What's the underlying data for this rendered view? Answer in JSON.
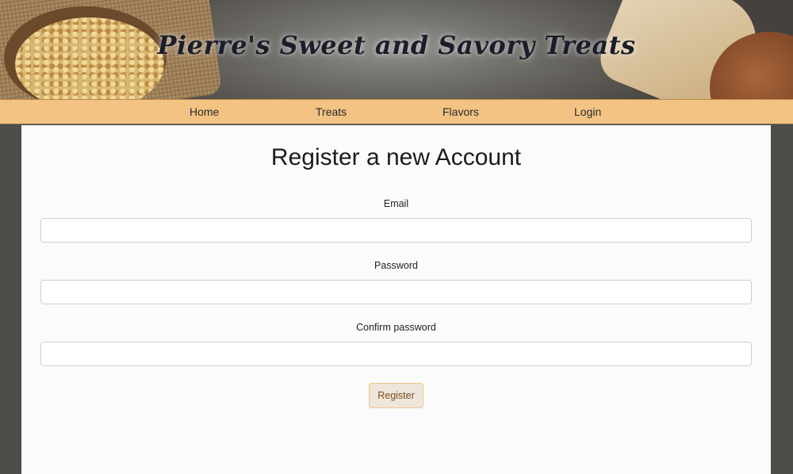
{
  "header": {
    "site_title": "Pierre's Sweet and Savory Treats"
  },
  "nav": {
    "items": [
      {
        "label": "Home"
      },
      {
        "label": "Treats"
      },
      {
        "label": "Flavors"
      },
      {
        "label": "Login"
      }
    ]
  },
  "form": {
    "heading": "Register a new Account",
    "email_label": "Email",
    "email_value": "",
    "password_label": "Password",
    "password_value": "",
    "confirm_label": "Confirm password",
    "confirm_value": "",
    "submit_label": "Register"
  },
  "colors": {
    "nav_background": "#f3c383",
    "page_background": "#4e4c47",
    "card_background": "#fbfbfb",
    "button_background": "#efe6db",
    "button_border": "#f0c48a",
    "button_text": "#7a4c1f"
  }
}
